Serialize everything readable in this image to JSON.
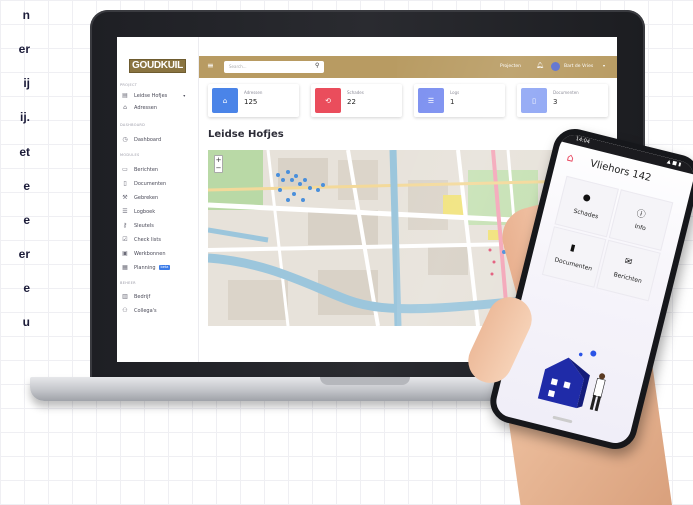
{
  "left_text": {
    "lines": [
      "n",
      "er",
      "ij",
      "ij.",
      "et",
      "e",
      "e",
      "er",
      "e",
      "u"
    ]
  },
  "app": {
    "logo_text": "GOUDKUIL",
    "header": {
      "search_placeholder": "Search...",
      "projects_label": "Projecten",
      "user_name": "Bart de Vries"
    },
    "sidebar": {
      "sections": [
        {
          "label": "PROJECT"
        },
        {
          "label": "DASHBOARD"
        },
        {
          "label": "MODULES"
        },
        {
          "label": "BEHEER"
        }
      ],
      "items": [
        {
          "label": "Leidse Hofjes",
          "icon": "building-icon"
        },
        {
          "label": "Adressen",
          "icon": "home-icon"
        },
        {
          "label": "Dashboard",
          "icon": "clock-icon"
        },
        {
          "label": "Berichten",
          "icon": "message-icon"
        },
        {
          "label": "Documenten",
          "icon": "document-icon"
        },
        {
          "label": "Gebreken",
          "icon": "wrench-icon"
        },
        {
          "label": "Logboek",
          "icon": "list-icon"
        },
        {
          "label": "Sleutels",
          "icon": "key-icon"
        },
        {
          "label": "Check lists",
          "icon": "checklist-icon"
        },
        {
          "label": "Werkbonnen",
          "icon": "clipboard-icon"
        },
        {
          "label": "Planning",
          "icon": "calendar-icon",
          "badge": "beta"
        },
        {
          "label": "Bedrijf",
          "icon": "company-icon"
        },
        {
          "label": "Collega's",
          "icon": "people-icon"
        }
      ]
    },
    "cards": [
      {
        "label": "Adressen",
        "value": "125",
        "color": "#4a84e8",
        "icon": "home-icon"
      },
      {
        "label": "Schades",
        "value": "22",
        "color": "#ea4d5c",
        "icon": "damage-icon"
      },
      {
        "label": "Logs",
        "value": "1",
        "color": "#7b8ff0",
        "icon": "log-icon"
      },
      {
        "label": "Documenten",
        "value": "3",
        "color": "#8fa6f4",
        "icon": "document-icon"
      }
    ],
    "page_title": "Leidse Hofjes",
    "map": {
      "zoom_in": "+",
      "zoom_out": "−",
      "water_color": "#9cc6dc",
      "park_color": "#b9d9a6"
    }
  },
  "phone": {
    "status_time": "14:04",
    "status_right": "▲ ■ ▮",
    "title": "Vliehors 142",
    "tiles": [
      {
        "label": "Schades",
        "icon": "alert-icon"
      },
      {
        "label": "Info",
        "icon": "info-icon"
      },
      {
        "label": "Documenten",
        "icon": "document-icon"
      },
      {
        "label": "Berichten",
        "icon": "envelope-icon"
      }
    ]
  }
}
